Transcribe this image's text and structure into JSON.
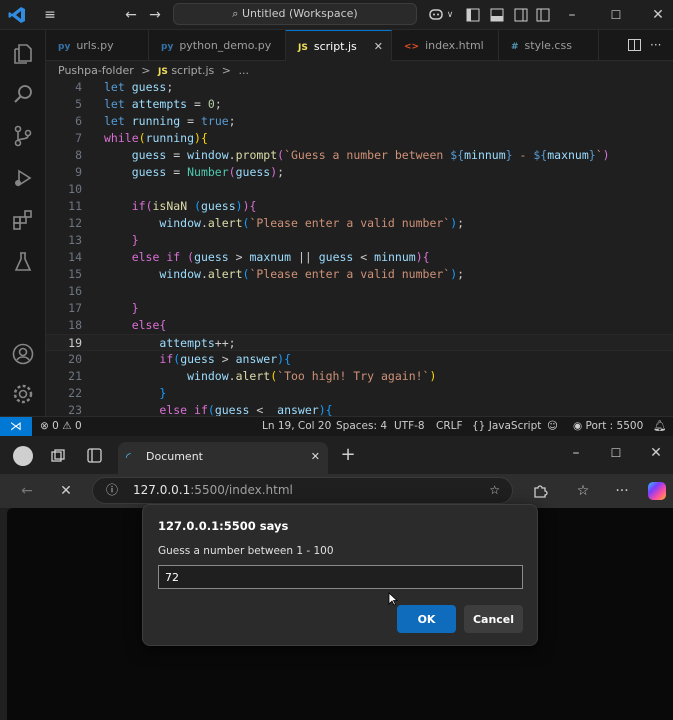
{
  "vscode": {
    "search_text": "Untitled (Workspace)",
    "tabs": [
      {
        "icon": "py",
        "label": "urls.py",
        "color": "#3572A5"
      },
      {
        "icon": "py",
        "label": "python_demo.py",
        "color": "#3572A5"
      },
      {
        "icon": "JS",
        "label": "script.js",
        "color": "#f1e05a",
        "close": "✕"
      },
      {
        "icon": "<>",
        "label": "index.html",
        "color": "#e44d26"
      },
      {
        "icon": "#",
        "label": "style.css",
        "color": "#519aba"
      }
    ],
    "breadcrumb": {
      "folder": "Pushpa-folder",
      "sep": ">",
      "file_icon": "JS",
      "file": "script.js",
      "more": "..."
    },
    "line_numbers": [
      "4",
      "5",
      "6",
      "7",
      "8",
      "9",
      "10",
      "11",
      "12",
      "13",
      "14",
      "15",
      "16",
      "17",
      "18",
      "19",
      "20",
      "21",
      "22",
      "23"
    ],
    "tokens": {
      "let": "let",
      "while": "while",
      "if": "if",
      "else": "else",
      "true": "true",
      "zero": "0",
      "guess": "guess",
      "attempts": "attempts",
      "running": "running",
      "window": "window",
      "prompt": "prompt",
      "alert": "alert",
      "Number": "Number",
      "isNaN": "isNaN",
      "maxnum": "maxnum",
      "minnum": "minnum",
      "answer": "answer",
      "prompt_str_a": "`Guess a number between ",
      "prompt_str_b": "${",
      "prompt_str_c": "}",
      "prompt_str_d": " - ",
      "prompt_str_e": "`",
      "valid_str": "`Please enter a valid number`",
      "high_str": "`Too high! Try again!`"
    },
    "status": {
      "errors": "0",
      "warnings": "0",
      "position": "Ln 19, Col 20",
      "spaces": "Spaces: 4",
      "encoding": "UTF-8",
      "eol": "CRLF",
      "language": "JavaScript",
      "port": "Port : 5500"
    }
  },
  "browser": {
    "tab_title": "Document",
    "url_host": "127.0.0.1",
    "url_rest": ":5500/index.html",
    "dialog": {
      "title": "127.0.0.1:5500 says",
      "message": "Guess a number between 1 - 100",
      "input_value": "72",
      "ok_label": "OK",
      "cancel_label": "Cancel"
    }
  }
}
